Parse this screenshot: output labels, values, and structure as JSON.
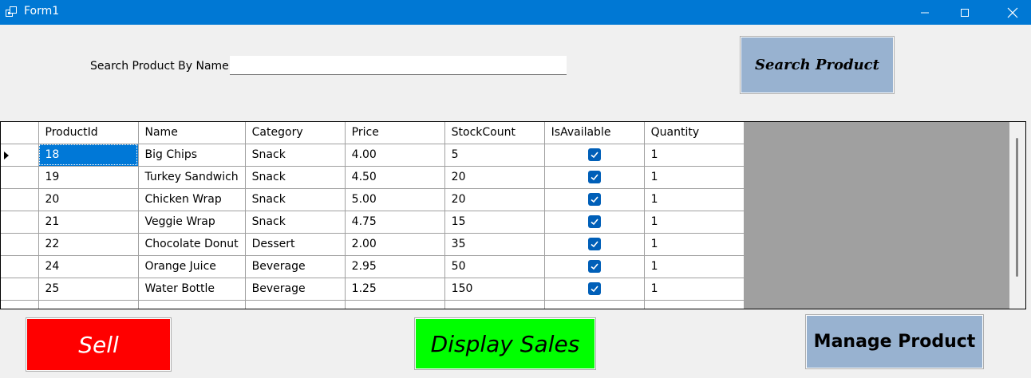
{
  "window": {
    "title": "Form1"
  },
  "search": {
    "label": "Search Product By Name",
    "value": "",
    "button_label": "Search Product"
  },
  "grid": {
    "columns": [
      "ProductId",
      "Name",
      "Category",
      "Price",
      "StockCount",
      "IsAvailable",
      "Quantity"
    ],
    "rows": [
      {
        "id": "18",
        "name": "Big Chips",
        "category": "Snack",
        "price": "4.00",
        "stock": "5",
        "available": true,
        "quantity": "1"
      },
      {
        "id": "19",
        "name": "Turkey Sandwich",
        "category": "Snack",
        "price": "4.50",
        "stock": "20",
        "available": true,
        "quantity": "1"
      },
      {
        "id": "20",
        "name": "Chicken Wrap",
        "category": "Snack",
        "price": "5.00",
        "stock": "20",
        "available": true,
        "quantity": "1"
      },
      {
        "id": "21",
        "name": "Veggie Wrap",
        "category": "Snack",
        "price": "4.75",
        "stock": "15",
        "available": true,
        "quantity": "1"
      },
      {
        "id": "22",
        "name": "Chocolate Donut",
        "category": "Dessert",
        "price": "2.00",
        "stock": "35",
        "available": true,
        "quantity": "1"
      },
      {
        "id": "24",
        "name": "Orange Juice",
        "category": "Beverage",
        "price": "2.95",
        "stock": "50",
        "available": true,
        "quantity": "1"
      },
      {
        "id": "25",
        "name": "Water Bottle",
        "category": "Beverage",
        "price": "1.25",
        "stock": "150",
        "available": true,
        "quantity": "1"
      }
    ]
  },
  "actions": {
    "sell_label": "Sell",
    "display_sales_label": "Display Sales",
    "manage_product_label": "Manage Product"
  },
  "colors": {
    "titlebar": "#0078d4",
    "sell": "#ff0000",
    "display_sales": "#00ff00",
    "manage": "#98b2d0",
    "selection": "#0078d7"
  }
}
